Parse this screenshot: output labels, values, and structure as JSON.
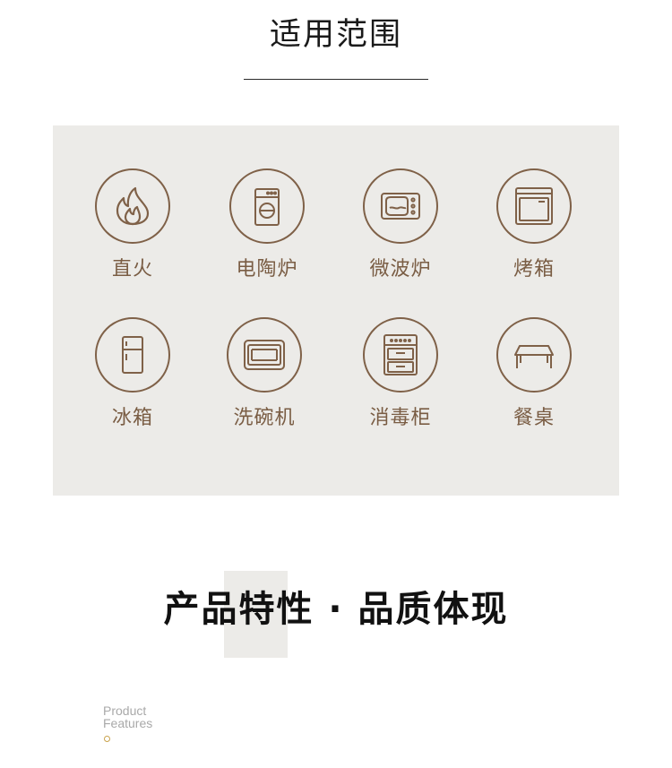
{
  "scope": {
    "title": "适用范围",
    "items": [
      {
        "label": "直火",
        "icon": "flame-icon"
      },
      {
        "label": "电陶炉",
        "icon": "ceramic-cooker-icon"
      },
      {
        "label": "微波炉",
        "icon": "microwave-icon"
      },
      {
        "label": "烤箱",
        "icon": "oven-icon"
      },
      {
        "label": "冰箱",
        "icon": "refrigerator-icon"
      },
      {
        "label": "洗碗机",
        "icon": "dishwasher-icon"
      },
      {
        "label": "消毒柜",
        "icon": "sterilizer-cabinet-icon"
      },
      {
        "label": "餐桌",
        "icon": "dining-table-icon"
      }
    ]
  },
  "features": {
    "title": "产品特性 · 品质体现",
    "english_line1": "Product",
    "english_line2": "Features"
  },
  "colors": {
    "accent_brown": "#7f6148",
    "panel_bg": "#ecebe8",
    "dot_gold": "#c9a34d"
  }
}
